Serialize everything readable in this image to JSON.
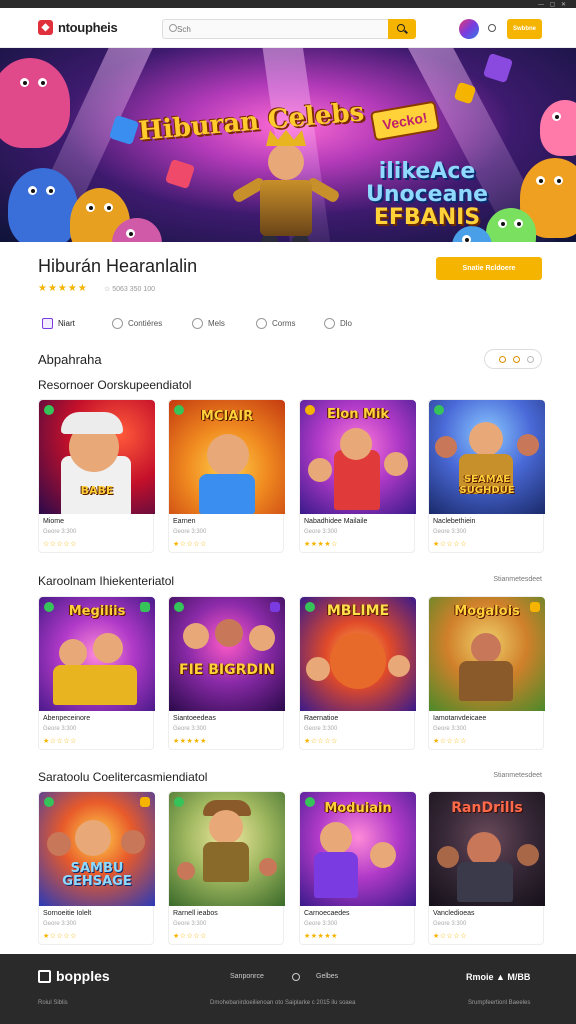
{
  "header": {
    "logo_glyph": "◆",
    "logo_text": "ntoupheis",
    "search_placeholder": "Sch",
    "signin_label": "Swbbne"
  },
  "hero": {
    "title_left": "Hiburan Celebs",
    "sign_text": "Vecko!",
    "title_right_1": "ilikeAce",
    "title_right_2": "Unoceane",
    "title_right_3": "EFBANIS"
  },
  "title": {
    "name": "Hiburán Hearanlalin",
    "stars": "★★★★★",
    "meta": "☆ 5063 350   100",
    "play_label": "Snatie Rcldoere"
  },
  "tabs": [
    {
      "label": "Niart"
    },
    {
      "label": "Contiéres"
    },
    {
      "label": "Mels"
    },
    {
      "label": "Corms"
    },
    {
      "label": "Dlo"
    }
  ],
  "about_heading": "Abpahraha",
  "sections": [
    {
      "heading": "Resornoer Oorskupeendiatol",
      "more": "",
      "cards": [
        {
          "name": "Miome",
          "meta": "Geore 3:300",
          "stars": "☆☆☆☆☆",
          "art": "BABE"
        },
        {
          "name": "Earnen",
          "meta": "Geore 3:300",
          "stars": "★☆☆☆☆",
          "art": "MCIAIR"
        },
        {
          "name": "Nabadhidee Mailaile",
          "meta": "Geore 3:300",
          "stars": "★★★★☆",
          "art": "Elon Mik"
        },
        {
          "name": "Naclebethiein",
          "meta": "Geore 3:300",
          "stars": "★☆☆☆☆",
          "art": "SEAMAE SUGHDUE"
        }
      ]
    },
    {
      "heading": "Karoolnam Ihiekenteriatol",
      "more": "Stianmetesdeet",
      "cards": [
        {
          "name": "Abenpeceinore",
          "meta": "Geore 3:300",
          "stars": "★☆☆☆☆",
          "art": "Megiliis"
        },
        {
          "name": "Siantoeedeas",
          "meta": "Geore 3:300",
          "stars": "★★★★★",
          "art": "FIE BIGRDIN"
        },
        {
          "name": "Raernatioe",
          "meta": "Geore 3:300",
          "stars": "★☆☆☆☆",
          "art": "MBLIME"
        },
        {
          "name": "Iamotanvdeicaee",
          "meta": "Geore 3:300",
          "stars": "★☆☆☆☆",
          "art": "Mogalois"
        }
      ]
    },
    {
      "heading": "Saratoolu Coelitercasmiendiatol",
      "more": "Stianmetesdeet",
      "cards": [
        {
          "name": "Sornoeitie Iolelt",
          "meta": "Geore 3:300",
          "stars": "★☆☆☆☆",
          "art": "SAMBU GEHSAGE"
        },
        {
          "name": "Rarnell ieabos",
          "meta": "Geore 3:300",
          "stars": "★☆☆☆☆",
          "art": ""
        },
        {
          "name": "Carnoecaedes",
          "meta": "Geore 3:300",
          "stars": "★★★★★",
          "art": "Moduiain"
        },
        {
          "name": "Vancledioeas",
          "meta": "Geore 3:300",
          "stars": "★☆☆☆☆",
          "art": "RanDrills"
        }
      ]
    }
  ],
  "footer": {
    "logo": "bopples",
    "links": [
      "Sanponrce",
      "Gelbes"
    ],
    "social": "Rmoie  ▲ M/BB",
    "copy_center": "Dmohebanirdoeilienoan oto Saiplarke c 2015 ilu soaea",
    "copy_left": "Roiul Siblis",
    "copy_right": "Srumpfeertionl Baeeles"
  },
  "colors": {
    "accent": "#f5b400",
    "brand_red": "#e0303c",
    "footer_bg": "#2a2a2a"
  }
}
